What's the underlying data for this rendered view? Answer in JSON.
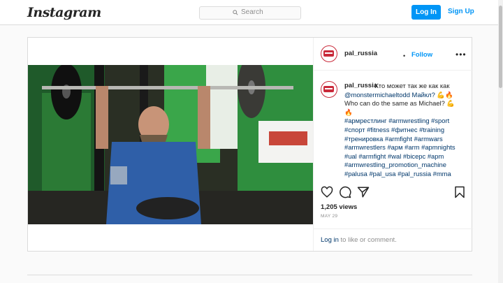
{
  "header": {
    "logo_text": "Instagram",
    "search_placeholder": "Search",
    "login_label": "Log In",
    "signup_label": "Sign Up"
  },
  "post": {
    "username": "pal_russia",
    "follow_label": "Follow",
    "caption_lines": [
      "Кто может так же как как",
      "@monstermichaeltodd Майкл? 💪🔥",
      "Who can do the same as Michael? 💪",
      "🔥",
      "#армрестлинг #armwrestling #sport",
      "#спорт #fitness #фитнес #training",
      "#тренировка #armfight #armwars",
      "#armwrestlers #арм #arm #apmnights",
      "#ual #armfight #wal #bicepc #apm",
      "#armwrestling_promotion_machine",
      "#palusa #pal_usa #pal_russia #mma"
    ],
    "views": "1,205 views",
    "date": "MAY 29",
    "comment_login_link": "Log in",
    "comment_text": " to like or comment."
  },
  "icons": {
    "search": "search-icon",
    "like": "heart-icon",
    "comment": "comment-icon",
    "share": "share-icon",
    "save": "bookmark-icon",
    "more": "more-options-icon"
  },
  "colors": {
    "accent": "#0095f6",
    "brand_red": "#c92a3a"
  }
}
